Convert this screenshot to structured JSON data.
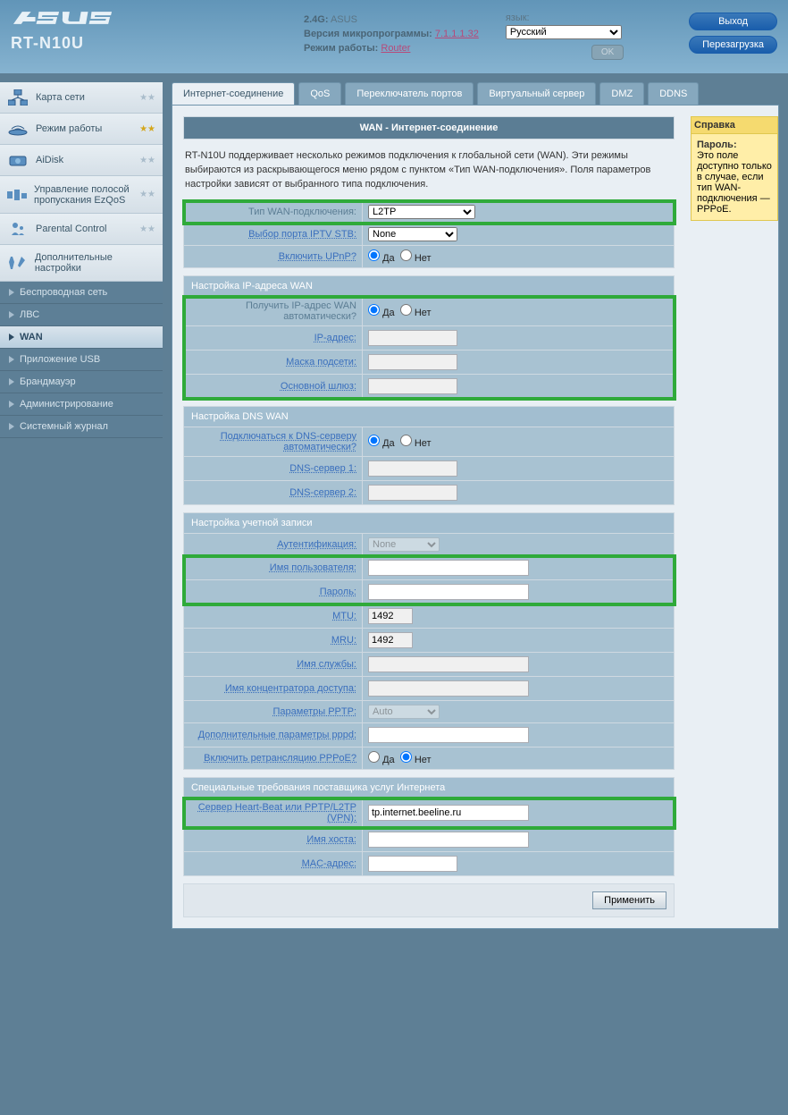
{
  "header": {
    "model": "RT-N10U",
    "ssid_label": "2.4G:",
    "ssid": "ASUS",
    "fw_label": "Версия микропрограммы:",
    "fw_version": "7.1.1.1.32",
    "mode_label": "Режим работы:",
    "mode_value": "Router",
    "lang_label": "язык:",
    "lang_value": "Русский",
    "ok": "OK",
    "logout": "Выход",
    "reboot": "Перезагрузка"
  },
  "sidebar": {
    "items": [
      {
        "label": "Карта сети"
      },
      {
        "label": "Режим работы"
      },
      {
        "label": "AiDisk"
      },
      {
        "label": "Управление полосой пропускания EzQoS"
      },
      {
        "label": "Parental Control"
      },
      {
        "label": "Дополнительные настройки"
      }
    ],
    "subnav": [
      {
        "label": "Беспроводная сеть"
      },
      {
        "label": "ЛВС"
      },
      {
        "label": "WAN"
      },
      {
        "label": "Приложение USB"
      },
      {
        "label": "Брандмауэр"
      },
      {
        "label": "Администрирование"
      },
      {
        "label": "Системный журнал"
      }
    ]
  },
  "tabs": [
    {
      "label": "Интернет-соединение"
    },
    {
      "label": "QoS"
    },
    {
      "label": "Переключатель портов"
    },
    {
      "label": "Виртуальный сервер"
    },
    {
      "label": "DMZ"
    },
    {
      "label": "DDNS"
    }
  ],
  "page": {
    "title": "WAN - Интернет-соединение",
    "intro": "RT-N10U поддерживает несколько режимов подключения к глобальной сети (WAN). Эти режимы выбираются из раскрывающегося меню рядом с пунктом «Тип WAN-подключения». Поля параметров настройки зависят от выбранного типа подключения.",
    "basic": {
      "wan_type_label": "Тип WAN-подключения:",
      "wan_type_value": "L2TP",
      "iptv_label": "Выбор порта IPTV STB:",
      "iptv_value": "None",
      "upnp_label": "Включить UPnP?",
      "yes": "Да",
      "no": "Нет"
    },
    "wan_ip": {
      "heading": "Настройка IP-адреса WAN",
      "auto_label": "Получить IP-адрес WAN автоматически?",
      "ip_label": "IP-адрес:",
      "mask_label": "Маска подсети:",
      "gw_label": "Основной шлюз:"
    },
    "dns": {
      "heading": "Настройка DNS WAN",
      "auto_label": "Подключаться к DNS-серверу автоматически?",
      "dns1_label": "DNS-сервер 1:",
      "dns2_label": "DNS-сервер 2:"
    },
    "account": {
      "heading": "Настройка учетной записи",
      "auth_label": "Аутентификация:",
      "auth_value": "None",
      "user_label": "Имя пользователя:",
      "pass_label": "Пароль:",
      "mtu_label": "MTU:",
      "mtu_value": "1492",
      "mru_label": "MRU:",
      "mru_value": "1492",
      "svc_label": "Имя службы:",
      "ac_label": "Имя концентратора доступа:",
      "pptp_label": "Параметры PPTP:",
      "pptp_value": "Auto",
      "pppd_label": "Дополнительные параметры pppd:",
      "relay_label": "Включить ретрансляцию PPPoE?"
    },
    "isp": {
      "heading": "Специальные требования поставщика услуг Интернета",
      "hb_label": "Сервер Heart-Beat или PPTP/L2TP (VPN):",
      "hb_value": "tp.internet.beeline.ru",
      "host_label": "Имя хоста:",
      "mac_label": "MAC-адрес:"
    },
    "apply": "Применить"
  },
  "help": {
    "title": "Справка",
    "pwd_title": "Пароль:",
    "body": "Это поле доступно только в случае, если тип WAN-подключения — PPPoE."
  }
}
